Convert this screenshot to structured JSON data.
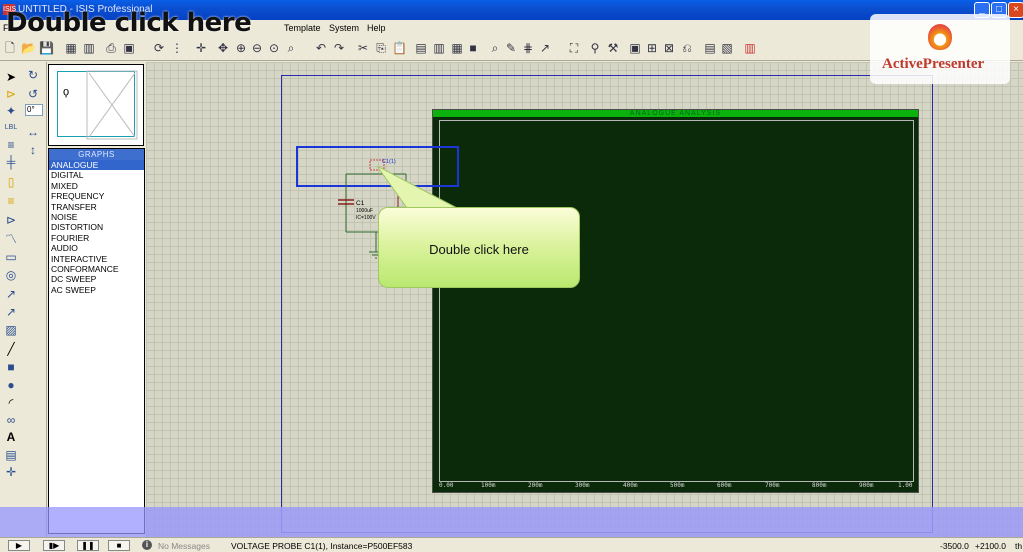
{
  "window": {
    "title": "UNTITLED - ISIS Professional",
    "app_icon": "ISIS"
  },
  "overlay_title": "Double click here",
  "menu": [
    "F",
    "Template",
    "System",
    "Help"
  ],
  "watermark": {
    "brand": "ActivePresenter"
  },
  "overview": {
    "angle_value": "0°"
  },
  "graphs_panel": {
    "header": "GRAPHS",
    "items": [
      "ANALOGUE",
      "DIGITAL",
      "MIXED",
      "FREQUENCY",
      "TRANSFER",
      "NOISE",
      "DISTORTION",
      "FOURIER",
      "AUDIO",
      "INTERACTIVE",
      "CONFORMANCE",
      "DC SWEEP",
      "AC SWEEP"
    ],
    "selected": "ANALOGUE"
  },
  "graph": {
    "title": "ANALOGUE ANALYSIS",
    "x_ticks": [
      "0.00",
      "100m",
      "200m",
      "300m",
      "400m",
      "500m",
      "600m",
      "700m",
      "800m",
      "900m",
      "1.00"
    ]
  },
  "circuit": {
    "probe_label": "C1(1)",
    "cap_name": "C1",
    "cap_value": "1000uF",
    "cap_ic": "IC=100V",
    "res_label": "R"
  },
  "callout": {
    "text": "Double click here"
  },
  "status": {
    "messages": "No Messages",
    "info": "VOLTAGE PROBE C1(1), Instance=P500EF583",
    "coord_x": "-3500.0",
    "coord_y": "+2100.0",
    "coord_unit": "th"
  },
  "colors": {
    "graph_bg": "#0a2a0a",
    "graph_title_bar": "#0cb20c",
    "selection_box": "#1c35d8",
    "callout_fill": "#d9f29a"
  }
}
